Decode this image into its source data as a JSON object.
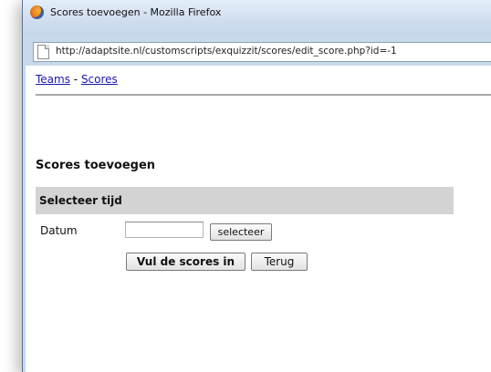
{
  "window": {
    "title": "Scores toevoegen - Mozilla Firefox",
    "url": "http://adaptsite.nl/customscripts/exquizzit/scores/edit_score.php?id=-1"
  },
  "nav": {
    "teams": "Teams",
    "separator": " - ",
    "scores": "Scores"
  },
  "page": {
    "heading": "Scores toevoegen",
    "section_title": "Selecteer tijd",
    "datum_label": "Datum",
    "datum_value": "",
    "selecteer_button": "selecteer",
    "submit_button": "Vul de scores in",
    "back_button": "Terug"
  }
}
